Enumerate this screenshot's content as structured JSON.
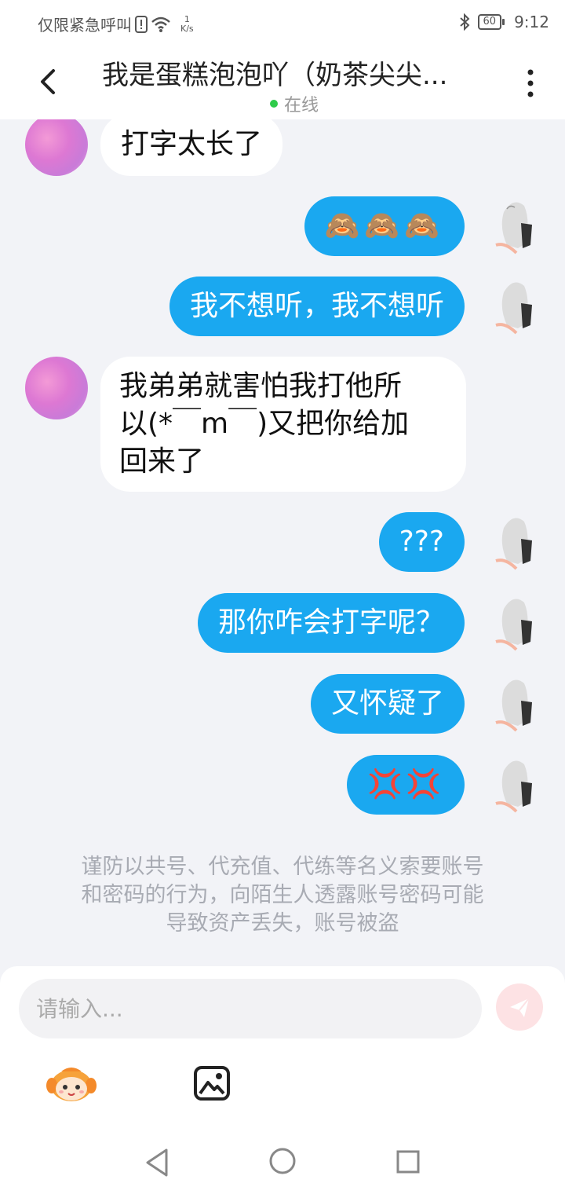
{
  "status": {
    "carrier": "仅限紧急呼叫",
    "speed_value": "1",
    "speed_unit": "K/s",
    "battery": "60",
    "time": "9:12"
  },
  "header": {
    "title": "我是蛋糕泡泡吖（奶茶尖尖...",
    "online_label": "在线",
    "online_color": "#2ecb4a"
  },
  "messages": [
    {
      "side": "in",
      "text": "打字太长了"
    },
    {
      "side": "out",
      "text": "🙈🙈🙈"
    },
    {
      "side": "out",
      "text": "我不想听，我不想听"
    },
    {
      "side": "in",
      "line1": "我弟弟就害怕我打他所",
      "line2": "以(*￣m￣)又把你给加",
      "line3": "回来了"
    },
    {
      "side": "out",
      "text": "???"
    },
    {
      "side": "out",
      "text": "那你咋会打字呢？"
    },
    {
      "side": "out",
      "text": "又怀疑了"
    },
    {
      "side": "out",
      "text": "💢💢"
    }
  ],
  "notice": {
    "line1": "谨防以共号、代充值、代练等名义索要账号",
    "line2": "和密码的行为，向陌生人透露账号密码可能",
    "line3": "导致资产丢失，账号被盗"
  },
  "input": {
    "placeholder": "请输入..."
  },
  "colors": {
    "bubble_out": "#1aa8f0",
    "bubble_in": "#ffffff",
    "background": "#f2f3f7",
    "send_button": "#fde2e4"
  },
  "icons": [
    "back-icon",
    "more-icon",
    "send-icon",
    "emoji-mascot-icon",
    "image-icon",
    "nav-back-icon",
    "nav-home-icon",
    "nav-recent-icon"
  ]
}
